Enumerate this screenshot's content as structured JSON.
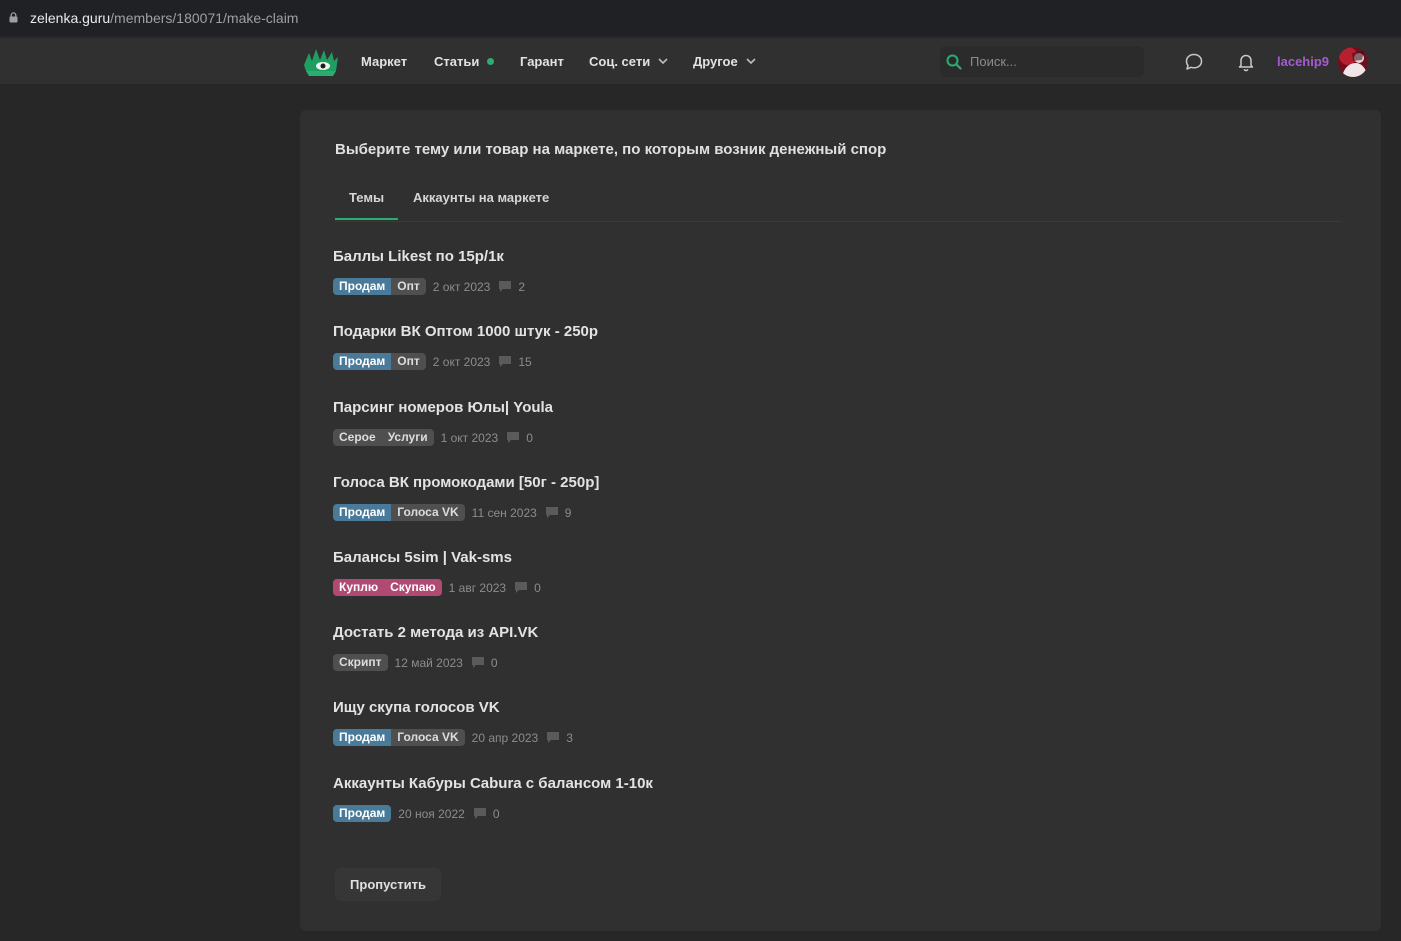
{
  "browser": {
    "url_host": "zelenka.guru",
    "url_path": "/members/180071/make-claim"
  },
  "nav": [
    {
      "label": "Маркет",
      "dot": false,
      "chevron": false
    },
    {
      "label": "Статьи",
      "dot": true,
      "chevron": false
    },
    {
      "label": "Гарант",
      "dot": false,
      "chevron": false
    },
    {
      "label": "Соц. сети",
      "dot": false,
      "chevron": true
    },
    {
      "label": "Другое",
      "dot": false,
      "chevron": true
    }
  ],
  "search": {
    "placeholder": "Поиск..."
  },
  "user": {
    "name": "lacehip9"
  },
  "colors": {
    "accent": "#2bad72",
    "username": "#a55bd0",
    "prefix_blue": "#4a7a99",
    "prefix_gray": "#4f4f4f",
    "prefix_pink": "#b04a73"
  },
  "main": {
    "title": "Выберите тему или товар на маркете, по которым возник денежный спор",
    "tabs": [
      {
        "label": "Темы",
        "active": true
      },
      {
        "label": "Аккаунты на маркете",
        "active": false
      }
    ],
    "threads": [
      {
        "title": "Баллы Likest по 15р/1к",
        "prefixes": [
          {
            "label": "Продам",
            "color": "blue"
          },
          {
            "label": "Опт",
            "color": "gray"
          }
        ],
        "date": "2 окт 2023",
        "replies": "2"
      },
      {
        "title": "Подарки ВК Оптом 1000 штук - 250р",
        "prefixes": [
          {
            "label": "Продам",
            "color": "blue"
          },
          {
            "label": "Опт",
            "color": "gray"
          }
        ],
        "date": "2 окт 2023",
        "replies": "15"
      },
      {
        "title": "Парсинг номеров Юлы| Youla",
        "prefixes": [
          {
            "label": "Серое",
            "color": "gray"
          },
          {
            "label": "Услуги",
            "color": "gray"
          }
        ],
        "date": "1 окт 2023",
        "replies": "0"
      },
      {
        "title": "Голоса ВК промокодами [50г - 250р]",
        "prefixes": [
          {
            "label": "Продам",
            "color": "blue"
          },
          {
            "label": "Голоса VK",
            "color": "gray"
          }
        ],
        "date": "11 сен 2023",
        "replies": "9"
      },
      {
        "title": "Балансы 5sim | Vak-sms",
        "prefixes": [
          {
            "label": "Куплю",
            "color": "pink"
          },
          {
            "label": "Скупаю",
            "color": "pink"
          }
        ],
        "date": "1 авг 2023",
        "replies": "0"
      },
      {
        "title": "Достать 2 метода из API.VK",
        "prefixes": [
          {
            "label": "Скрипт",
            "color": "gray"
          }
        ],
        "date": "12 май 2023",
        "replies": "0"
      },
      {
        "title": "Ищу скупа голосов VK",
        "prefixes": [
          {
            "label": "Продам",
            "color": "blue"
          },
          {
            "label": "Голоса VK",
            "color": "gray"
          }
        ],
        "date": "20 апр 2023",
        "replies": "3"
      },
      {
        "title": "Аккаунты Кабуры Cabura с балансом 1-10к",
        "prefixes": [
          {
            "label": "Продам",
            "color": "blue"
          }
        ],
        "date": "20 ноя 2022",
        "replies": "0"
      }
    ],
    "skip_label": "Пропустить"
  }
}
